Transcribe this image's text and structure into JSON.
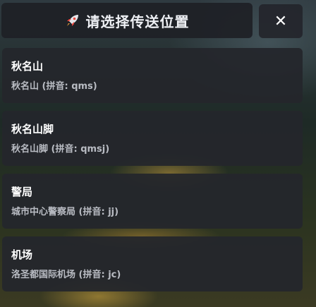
{
  "header": {
    "title": "请选择传送位置",
    "icon": "rocket-icon",
    "close_label": "✕"
  },
  "locations": [
    {
      "name": "秋名山",
      "detail": "秋名山 (拼音: qms)"
    },
    {
      "name": "秋名山脚",
      "detail": "秋名山脚 (拼音: qmsj)"
    },
    {
      "name": "警局",
      "detail": "城市中心警察局 (拼音: jj)"
    },
    {
      "name": "机场",
      "detail": "洛圣都国际机场 (拼音: jc)"
    }
  ],
  "colors": {
    "panel": "#24262c",
    "text": "#ffffff",
    "subtext": "#b9bcc3",
    "rocket": "#e8453c"
  }
}
